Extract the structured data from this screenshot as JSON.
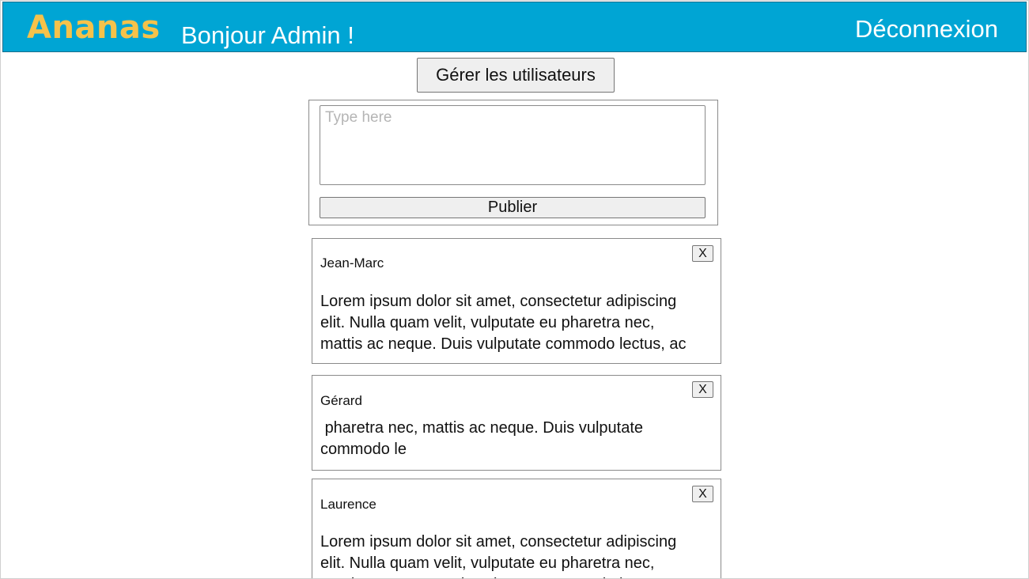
{
  "header": {
    "logo": "Ananas",
    "greeting": "Bonjour Admin !",
    "logout_label": "Déconnexion",
    "background_color": "#00a5d4",
    "logo_color": "#f5c24a"
  },
  "manage_users_label": "Gérer les utilisateurs",
  "composer": {
    "placeholder": "Type here",
    "value": "",
    "publish_label": "Publier"
  },
  "posts": [
    {
      "author": "Jean-Marc",
      "content": "Lorem ipsum dolor sit amet, consectetur adipiscing elit. Nulla quam velit, vulputate eu pharetra nec, mattis ac neque. Duis vulputate commodo lectus, ac",
      "delete_label": "X"
    },
    {
      "author": "Gérard",
      "content": " pharetra nec, mattis ac neque. Duis vulputate commodo le",
      "delete_label": "X"
    },
    {
      "author": "Laurence",
      "content": "Lorem ipsum dolor sit amet, consectetur adipiscing elit. Nulla quam velit, vulputate eu pharetra nec, mattis ac neque. Duis vulputate commodo lectus, ac",
      "delete_label": "X"
    }
  ]
}
